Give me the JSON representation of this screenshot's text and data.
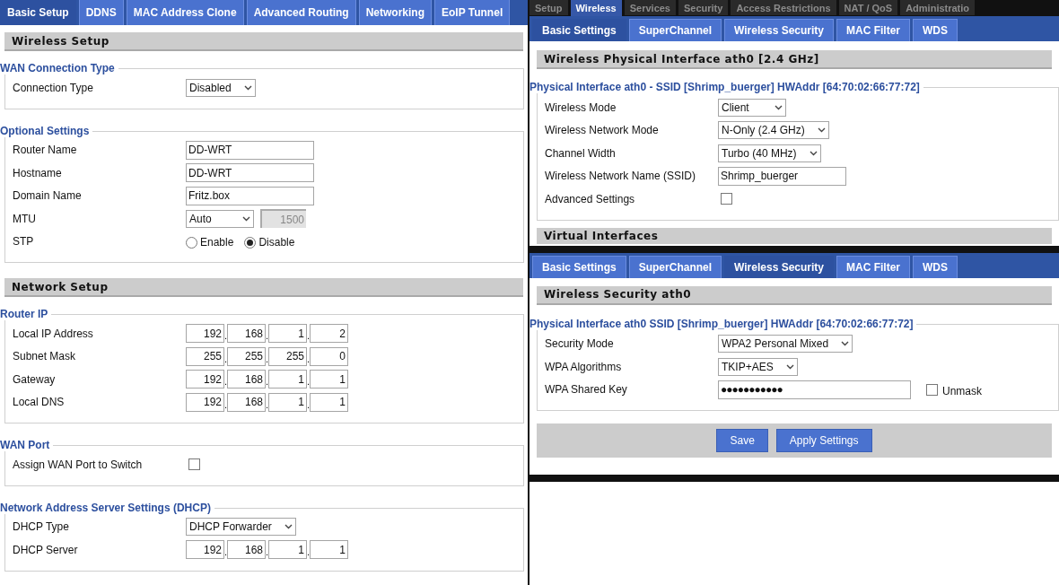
{
  "left": {
    "tabs": [
      {
        "label": "Basic Setup",
        "selected": true
      },
      {
        "label": "DDNS",
        "selected": false
      },
      {
        "label": "MAC Address Clone",
        "selected": false
      },
      {
        "label": "Advanced Routing",
        "selected": false
      },
      {
        "label": "Networking",
        "selected": false
      },
      {
        "label": "EoIP Tunnel",
        "selected": false
      }
    ],
    "sections": [
      {
        "title": "Wireless Setup",
        "groups": [
          {
            "legend": "WAN Connection Type",
            "rows": [
              {
                "kind": "select",
                "label": "Connection Type",
                "value": "Disabled"
              }
            ]
          },
          {
            "legend": "Optional Settings",
            "rows": [
              {
                "kind": "text",
                "label": "Router Name",
                "value": "DD-WRT"
              },
              {
                "kind": "text",
                "label": "Hostname",
                "value": "DD-WRT"
              },
              {
                "kind": "text",
                "label": "Domain Name",
                "value": "Fritz.box"
              },
              {
                "kind": "mtu",
                "label": "MTU",
                "value": "Auto",
                "field": "1500",
                "field_disabled": true
              },
              {
                "kind": "radio",
                "label": "STP",
                "options": [
                  {
                    "label": "Enable",
                    "selected": false
                  },
                  {
                    "label": "Disable",
                    "selected": true
                  }
                ]
              }
            ]
          }
        ]
      },
      {
        "title": "Network Setup",
        "groups": [
          {
            "legend": "Router IP",
            "rows": [
              {
                "kind": "ip",
                "label": "Local IP Address",
                "octets": [
                  "192",
                  "168",
                  "1",
                  "2"
                ],
                "separator": "."
              },
              {
                "kind": "ip",
                "label": "Subnet Mask",
                "octets": [
                  "255",
                  "255",
                  "255",
                  "0"
                ],
                "separator": "."
              },
              {
                "kind": "ip",
                "label": "Gateway",
                "octets": [
                  "192",
                  "168",
                  "1",
                  "1"
                ],
                "separator": "."
              },
              {
                "kind": "ip",
                "label": "Local DNS",
                "octets": [
                  "192",
                  "168",
                  "1",
                  "1"
                ],
                "separator": "."
              }
            ]
          },
          {
            "legend": "WAN Port",
            "rows": [
              {
                "kind": "checkbox",
                "label": "Assign WAN Port to Switch",
                "checked": false
              }
            ]
          },
          {
            "legend": "Network Address Server Settings (DHCP)",
            "rows": [
              {
                "kind": "select",
                "label": "DHCP Type",
                "value": "DHCP Forwarder"
              },
              {
                "kind": "ip",
                "label": "DHCP Server",
                "octets": [
                  "192",
                  "168",
                  "1",
                  "1"
                ],
                "separator": "."
              }
            ]
          }
        ]
      }
    ]
  },
  "right_top": {
    "main_tabs": [
      {
        "label": "Setup",
        "selected": false
      },
      {
        "label": "Wireless",
        "selected": true
      },
      {
        "label": "Services",
        "selected": false
      },
      {
        "label": "Security",
        "selected": false
      },
      {
        "label": "Access Restrictions",
        "selected": false
      },
      {
        "label": "NAT / QoS",
        "selected": false
      },
      {
        "label": "Administratio",
        "selected": false
      }
    ],
    "sub_tabs": [
      {
        "label": "Basic Settings",
        "selected": true
      },
      {
        "label": "SuperChannel",
        "selected": false
      },
      {
        "label": "Wireless Security",
        "selected": false
      },
      {
        "label": "MAC Filter",
        "selected": false
      },
      {
        "label": "WDS",
        "selected": false
      }
    ],
    "header": "Wireless Physical Interface ath0 [2.4 GHz]",
    "legend": "Physical Interface ath0 - SSID [Shrimp_buerger] HWAddr [64:70:02:66:77:72]",
    "rows": [
      {
        "kind": "select",
        "label": "Wireless Mode",
        "value": "Client"
      },
      {
        "kind": "select",
        "label": "Wireless Network Mode",
        "value": "N-Only (2.4 GHz)"
      },
      {
        "kind": "select",
        "label": "Channel Width",
        "value": "Turbo (40 MHz)"
      },
      {
        "kind": "text",
        "label": "Wireless Network Name (SSID)",
        "value": "Shrimp_buerger"
      },
      {
        "kind": "checkbox",
        "label": "Advanced Settings",
        "checked": false
      }
    ],
    "next_header": "Virtual Interfaces"
  },
  "right_bottom": {
    "sub_tabs": [
      {
        "label": "Basic Settings",
        "selected": false
      },
      {
        "label": "SuperChannel",
        "selected": false
      },
      {
        "label": "Wireless Security",
        "selected": true
      },
      {
        "label": "MAC Filter",
        "selected": false
      },
      {
        "label": "WDS",
        "selected": false
      }
    ],
    "header": "Wireless Security ath0",
    "legend": "Physical Interface ath0 SSID [Shrimp_buerger] HWAddr [64:70:02:66:77:72]",
    "rows": [
      {
        "kind": "select",
        "label": "Security Mode",
        "value": "WPA2 Personal Mixed"
      },
      {
        "kind": "select",
        "label": "WPA Algorithms",
        "value": "TKIP+AES"
      },
      {
        "kind": "password",
        "label": "WPA Shared Key",
        "value": "●●●●●●●●●●●",
        "unmask_label": "Unmask",
        "unmask": false
      }
    ],
    "buttons": [
      "Save",
      "Apply Settings"
    ]
  }
}
